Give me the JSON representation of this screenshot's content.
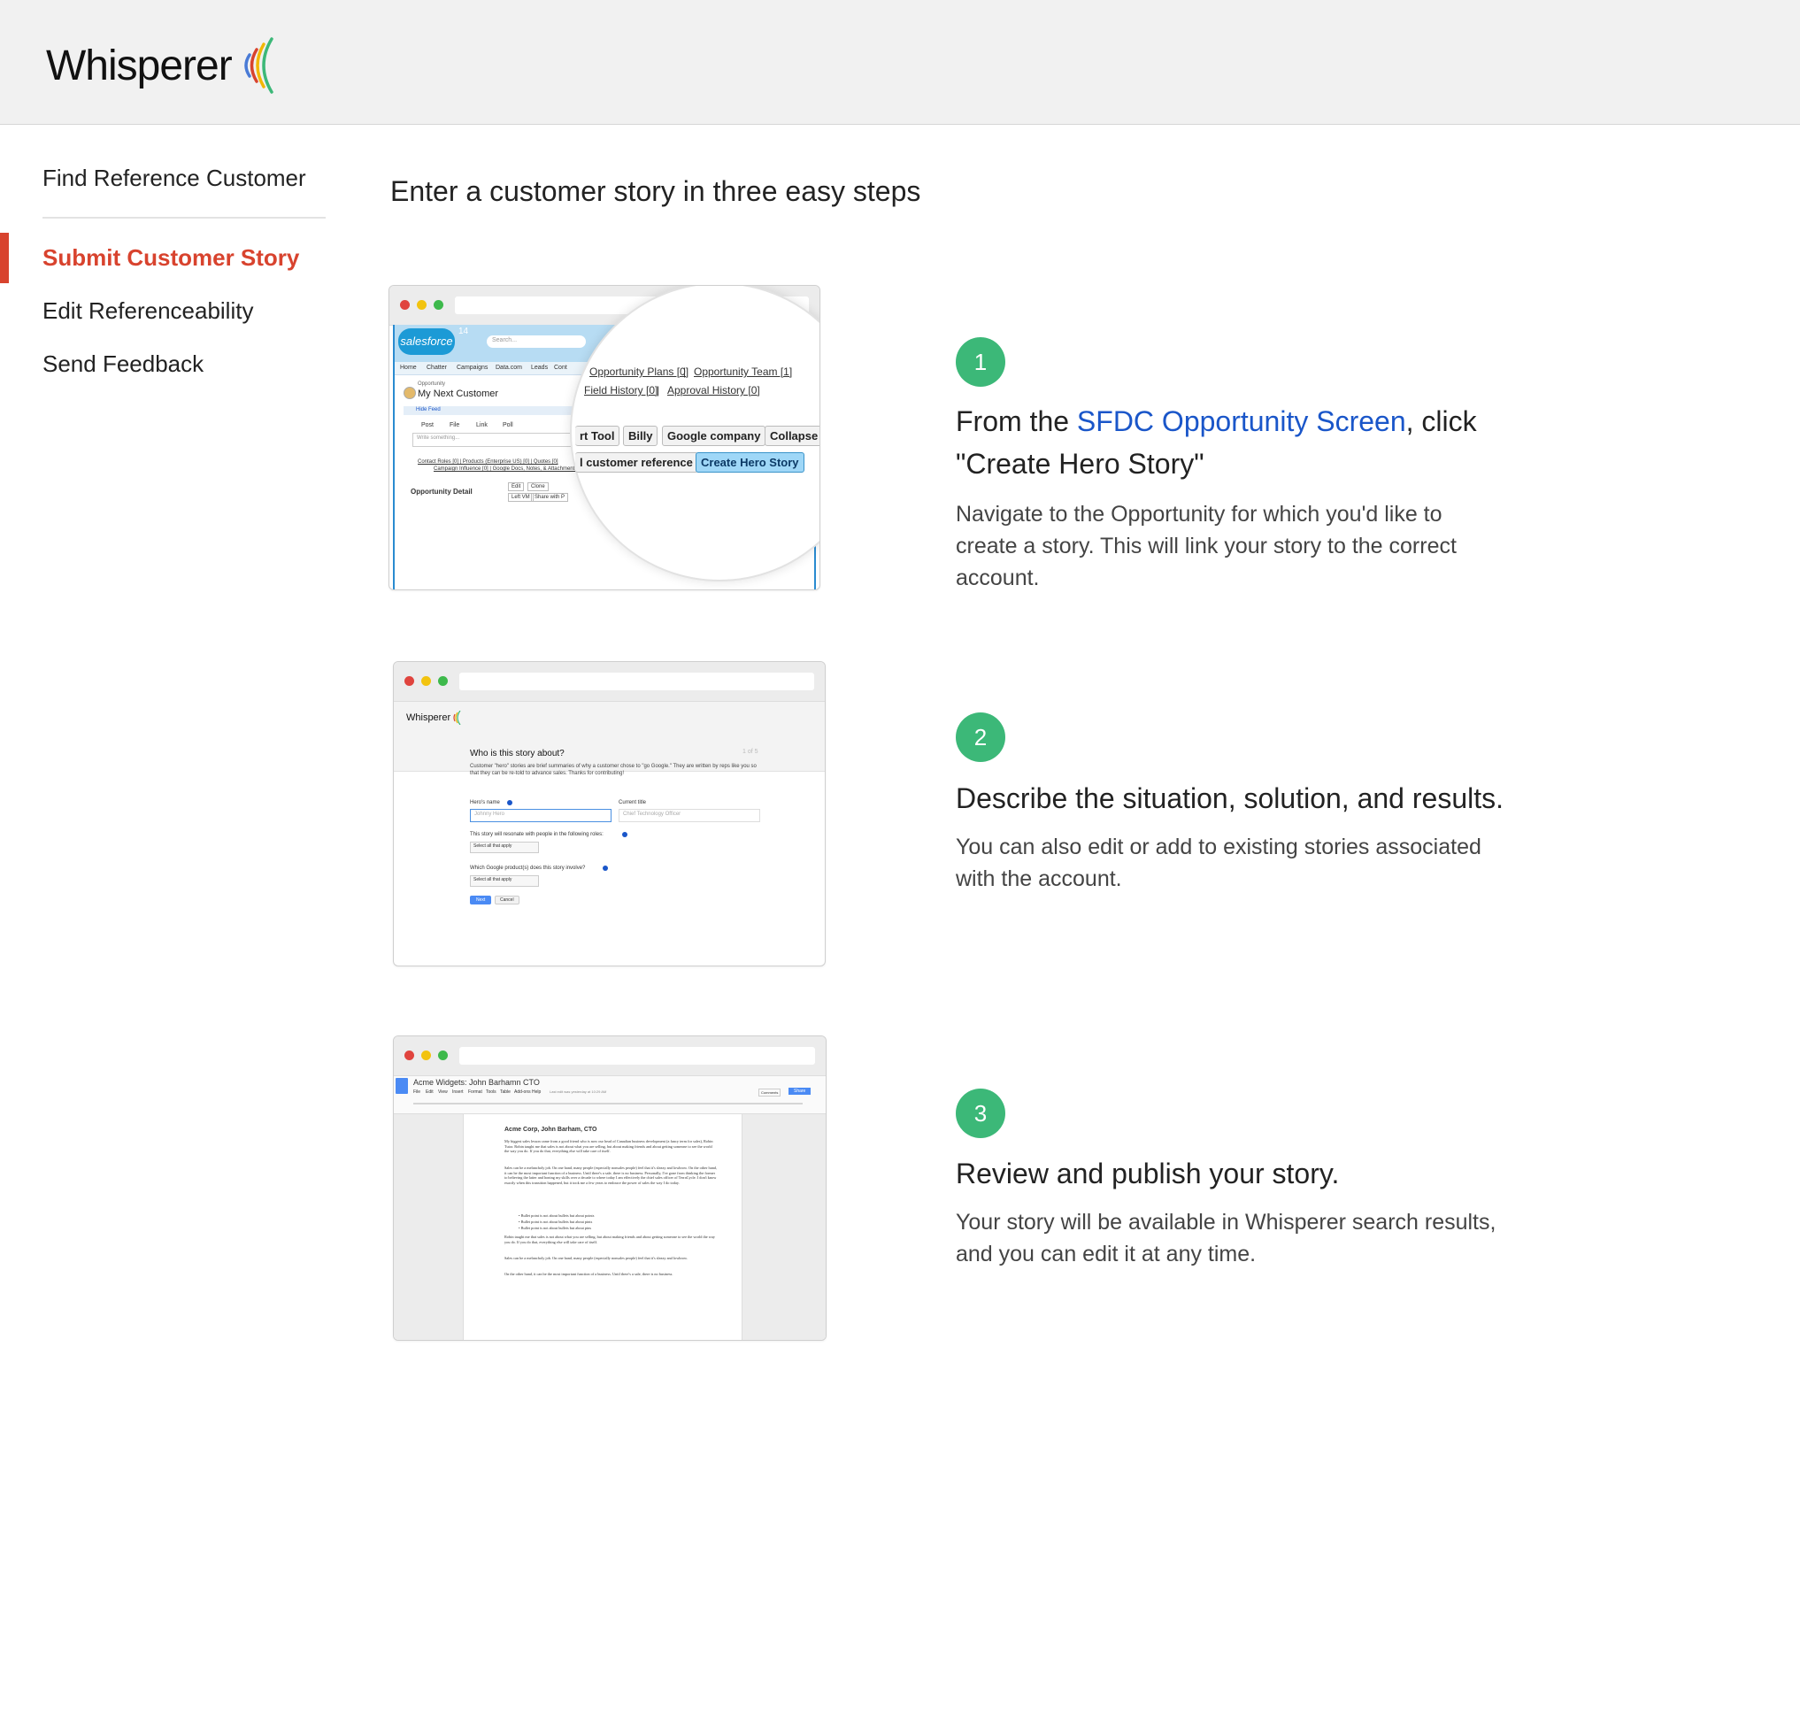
{
  "header": {
    "logo_text": "Whisperer"
  },
  "sidebar": {
    "items": [
      {
        "label": "Find Reference Customer"
      },
      {
        "label": "Submit Customer Story"
      },
      {
        "label": "Edit Referenceability"
      },
      {
        "label": "Send Feedback"
      }
    ],
    "active_color": "#d8432e"
  },
  "main": {
    "title": "Enter a customer story in three easy steps",
    "steps": [
      {
        "number": "1",
        "title_pre": "From the ",
        "title_link": "SFDC Opportunity Screen",
        "title_post": ", click \"Create Hero Story\"",
        "description": "Navigate to the Opportunity for which you'd like to create a story. This will link your story to the correct account."
      },
      {
        "number": "2",
        "title": "Describe the situation, solution, and results.",
        "description": "You can also edit or add to existing stories associated with the account."
      },
      {
        "number": "3",
        "title": "Review and publish your story.",
        "description": "Your story will be available in Whisperer search results, and you can edit it at any time."
      }
    ],
    "badge_color": "#3cb878",
    "link_color": "#1a56c9"
  },
  "screenshots": {
    "sfdc": {
      "brand": "salesforce",
      "badge": "14",
      "search_placeholder": "Search...",
      "nav": [
        "Home",
        "Chatter",
        "Campaigns",
        "Data.com",
        "Leads",
        "Cont"
      ],
      "record_type": "Opportunity",
      "record_name": "My Next Customer",
      "hide_feed": "Hide Feed",
      "feed_actions": [
        "Post",
        "File",
        "Link",
        "Poll"
      ],
      "write_placeholder": "Write something...",
      "related_links_1": "Contact Roles [0]  |  Products (Enterprise US) [0]  |  Quotes [0]",
      "related_links_2": "Campaign Influence [0]  |  Google Docs, Notes, & Attachments",
      "detail_label": "Opportunity Detail",
      "small_buttons": [
        "Edit",
        "Clone",
        "Left VM",
        "Share with P"
      ],
      "zoom_links": [
        "Opportunity Plans [0]",
        "Opportunity Team [1]",
        "Field History [0]",
        "Approval History [0]"
      ],
      "zoom_buttons_row1": [
        "rt Tool",
        "Billy",
        "Google company",
        "Collapse all"
      ],
      "zoom_buttons_row2": [
        "l customer reference",
        "Create Hero Story"
      ]
    },
    "form": {
      "logo_text": "Whisperer",
      "heading": "Who is this story about?",
      "step_counter": "1 of 5",
      "intro": "Customer \"hero\" stories are brief summaries of why a customer chose to \"go Google.\" They are written by reps like you so that they can be re-told to advance sales. Thanks for contributing!",
      "hero_label": "Hero's name",
      "hero_placeholder": "Johnny Hero",
      "title_label": "Current title",
      "title_placeholder": "Chief Technology Officer",
      "roles_label": "This story will resonate with people in the following roles:",
      "products_label": "Which Google product(s) does this story involve?",
      "select_text": "Select all that apply",
      "next_button": "Next",
      "cancel_button": "Cancel"
    },
    "doc": {
      "doc_title": "Acme Widgets: John Barhamn CTO",
      "menu": [
        "File",
        "Edit",
        "View",
        "Insert",
        "Format",
        "Tools",
        "Table",
        "Add-ons",
        "Help"
      ],
      "last_edit": "Last edit was yesterday at 10:29 AM",
      "comments_button": "Comments",
      "share_button": "Share",
      "heading": "Acme Corp, John Barham, CTO",
      "paragraphs": [
        "My biggest sales lesson came from a good friend who is now our head of Canadian business development (a fancy term for sales), Robin Tutor. Robin taught me that sales is not about what you are selling, but about making friends and about getting someone to see the world the way you do. If you do that, everything else will take care of itself.",
        "Sales can be a melancholy job. On one hand, many people (especially nonsales people) feel that it's sleazy and lowbrow. On the other hand, it can be the most important function of a business. Until there's a sale, there is no business. Personally, I've gone from thinking the former to believing the latter and honing my skills over a decade to where today I am effectively the chief sales officer of TerraCycle. I don't know exactly when this transition happened, but it took me a few years to embrace the power of sales the way I do today."
      ],
      "bullets": [
        "Bullet point is not about bullets but about points",
        "Bullet point is not about bullets but about pints",
        "Bullet point is not about bullets but about pins"
      ],
      "paragraphs_2": [
        "Robin taught me that sales is not about what you are selling, but about making friends and about getting someone to see the world the way you do. If you do that, everything else will take care of itself.",
        "Sales can be a melancholy job. On one hand, many people (especially nonsales people) feel that it's sleazy and lowbrow.",
        "On the other hand, it can be the most important function of a business. Until there's a sale, there is no business."
      ]
    }
  }
}
